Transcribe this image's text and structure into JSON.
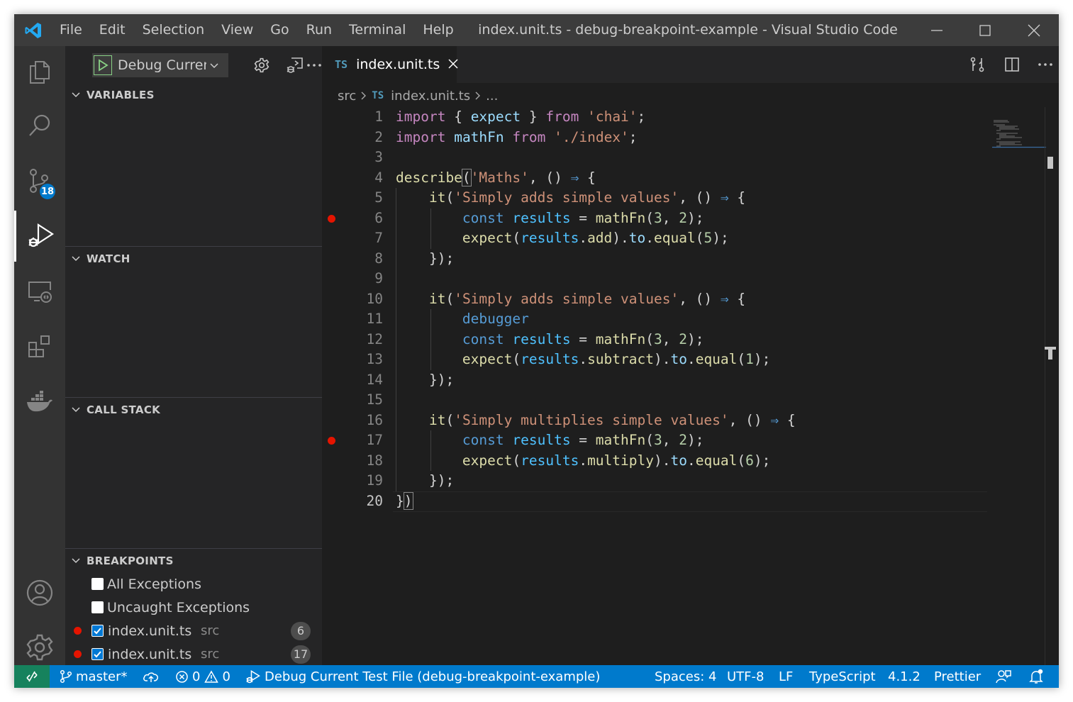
{
  "window": {
    "title": "index.unit.ts - debug-breakpoint-example - Visual Studio Code"
  },
  "menu": [
    "File",
    "Edit",
    "Selection",
    "View",
    "Go",
    "Run",
    "Terminal",
    "Help"
  ],
  "activity_bar": {
    "items": [
      "explorer-icon",
      "search-icon",
      "source-control-icon",
      "run-debug-icon",
      "remote-explorer-icon",
      "extensions-icon",
      "docker-icon"
    ],
    "source_control_badge": "18",
    "bottom": [
      "accounts-icon",
      "manage-gear-icon"
    ]
  },
  "debug": {
    "config_label": "Debug Current Test File"
  },
  "sidebar": {
    "variables_title": "VARIABLES",
    "watch_title": "WATCH",
    "callstack_title": "CALL STACK",
    "breakpoints_title": "BREAKPOINTS",
    "breakpoints": [
      {
        "label": "All Exceptions",
        "checked": false
      },
      {
        "label": "Uncaught Exceptions",
        "checked": false
      },
      {
        "label": "index.unit.ts",
        "path": "src",
        "line": "6",
        "checked": true
      },
      {
        "label": "index.unit.ts",
        "path": "src",
        "line": "17",
        "checked": true
      }
    ]
  },
  "editor": {
    "tab_label": "index.unit.ts",
    "tab_lang": "TS",
    "breadcrumb": {
      "folder": "src",
      "file": "index.unit.ts",
      "more": "..."
    },
    "current_line": 20,
    "breakpoint_lines": [
      6,
      17
    ],
    "code": [
      [
        [
          "kw",
          "import"
        ],
        [
          "pl",
          " { "
        ],
        [
          "prop",
          "expect"
        ],
        [
          "pl",
          " } "
        ],
        [
          "kw",
          "from"
        ],
        [
          "pl",
          " "
        ],
        [
          "str",
          "'chai'"
        ],
        [
          "pl",
          ";"
        ]
      ],
      [
        [
          "kw",
          "import"
        ],
        [
          "pl",
          " "
        ],
        [
          "prop",
          "mathFn"
        ],
        [
          "pl",
          " "
        ],
        [
          "kw",
          "from"
        ],
        [
          "pl",
          " "
        ],
        [
          "str",
          "'./index'"
        ],
        [
          "pl",
          ";"
        ]
      ],
      [],
      [
        [
          "fn",
          "describe"
        ],
        [
          "bm",
          "("
        ],
        [
          "str",
          "'Maths'"
        ],
        [
          "pl",
          ", () "
        ],
        [
          "bl",
          "⇒"
        ],
        [
          "pl",
          " {"
        ]
      ],
      [
        [
          "pl",
          "    "
        ],
        [
          "fn",
          "it"
        ],
        [
          "pl",
          "("
        ],
        [
          "str",
          "'Simply adds simple values'"
        ],
        [
          "pl",
          ", () "
        ],
        [
          "bl",
          "⇒"
        ],
        [
          "pl",
          " {"
        ]
      ],
      [
        [
          "pl",
          "        "
        ],
        [
          "bl",
          "const"
        ],
        [
          "pl",
          " "
        ],
        [
          "var",
          "results"
        ],
        [
          "pl",
          " = "
        ],
        [
          "fn",
          "mathFn"
        ],
        [
          "pl",
          "("
        ],
        [
          "num",
          "3"
        ],
        [
          "pl",
          ", "
        ],
        [
          "num",
          "2"
        ],
        [
          "pl",
          ");"
        ]
      ],
      [
        [
          "pl",
          "        "
        ],
        [
          "fn",
          "expect"
        ],
        [
          "pl",
          "("
        ],
        [
          "var",
          "results"
        ],
        [
          "pl",
          "."
        ],
        [
          "fn",
          "add"
        ],
        [
          "pl",
          ")."
        ],
        [
          "prop",
          "to"
        ],
        [
          "pl",
          "."
        ],
        [
          "fn",
          "equal"
        ],
        [
          "pl",
          "("
        ],
        [
          "num",
          "5"
        ],
        [
          "pl",
          ");"
        ]
      ],
      [
        [
          "pl",
          "    });"
        ]
      ],
      [],
      [
        [
          "pl",
          "    "
        ],
        [
          "fn",
          "it"
        ],
        [
          "pl",
          "("
        ],
        [
          "str",
          "'Simply adds simple values'"
        ],
        [
          "pl",
          ", () "
        ],
        [
          "bl",
          "⇒"
        ],
        [
          "pl",
          " {"
        ]
      ],
      [
        [
          "pl",
          "        "
        ],
        [
          "bl",
          "debugger"
        ]
      ],
      [
        [
          "pl",
          "        "
        ],
        [
          "bl",
          "const"
        ],
        [
          "pl",
          " "
        ],
        [
          "var",
          "results"
        ],
        [
          "pl",
          " = "
        ],
        [
          "fn",
          "mathFn"
        ],
        [
          "pl",
          "("
        ],
        [
          "num",
          "3"
        ],
        [
          "pl",
          ", "
        ],
        [
          "num",
          "2"
        ],
        [
          "pl",
          ");"
        ]
      ],
      [
        [
          "pl",
          "        "
        ],
        [
          "fn",
          "expect"
        ],
        [
          "pl",
          "("
        ],
        [
          "var",
          "results"
        ],
        [
          "pl",
          "."
        ],
        [
          "fn",
          "subtract"
        ],
        [
          "pl",
          ")."
        ],
        [
          "prop",
          "to"
        ],
        [
          "pl",
          "."
        ],
        [
          "fn",
          "equal"
        ],
        [
          "pl",
          "("
        ],
        [
          "num",
          "1"
        ],
        [
          "pl",
          ");"
        ]
      ],
      [
        [
          "pl",
          "    });"
        ]
      ],
      [],
      [
        [
          "pl",
          "    "
        ],
        [
          "fn",
          "it"
        ],
        [
          "pl",
          "("
        ],
        [
          "str",
          "'Simply multiplies simple values'"
        ],
        [
          "pl",
          ", () "
        ],
        [
          "bl",
          "⇒"
        ],
        [
          "pl",
          " {"
        ]
      ],
      [
        [
          "pl",
          "        "
        ],
        [
          "bl",
          "const"
        ],
        [
          "pl",
          " "
        ],
        [
          "var",
          "results"
        ],
        [
          "pl",
          " = "
        ],
        [
          "fn",
          "mathFn"
        ],
        [
          "pl",
          "("
        ],
        [
          "num",
          "3"
        ],
        [
          "pl",
          ", "
        ],
        [
          "num",
          "2"
        ],
        [
          "pl",
          ");"
        ]
      ],
      [
        [
          "pl",
          "        "
        ],
        [
          "fn",
          "expect"
        ],
        [
          "pl",
          "("
        ],
        [
          "var",
          "results"
        ],
        [
          "pl",
          "."
        ],
        [
          "fn",
          "multiply"
        ],
        [
          "pl",
          ")."
        ],
        [
          "prop",
          "to"
        ],
        [
          "pl",
          "."
        ],
        [
          "fn",
          "equal"
        ],
        [
          "pl",
          "("
        ],
        [
          "num",
          "6"
        ],
        [
          "pl",
          ");"
        ]
      ],
      [
        [
          "pl",
          "    });"
        ]
      ],
      [
        [
          "pl",
          "}"
        ],
        [
          "bm",
          ")"
        ]
      ]
    ]
  },
  "statusbar": {
    "branch": "master*",
    "errors": "0",
    "warnings": "0",
    "debug_config": "Debug Current Test File (debug-breakpoint-example)",
    "spaces": "Spaces: 4",
    "encoding": "UTF-8",
    "eol": "LF",
    "language": "TypeScript",
    "ts_version": "4.1.2",
    "formatter": "Prettier"
  },
  "colors": {
    "accent": "#007acc",
    "remote": "#16825d",
    "breakpoint": "#e51400",
    "titlebar": "#3c3c3c",
    "sidebar": "#252526",
    "editor": "#1e1e1e"
  }
}
